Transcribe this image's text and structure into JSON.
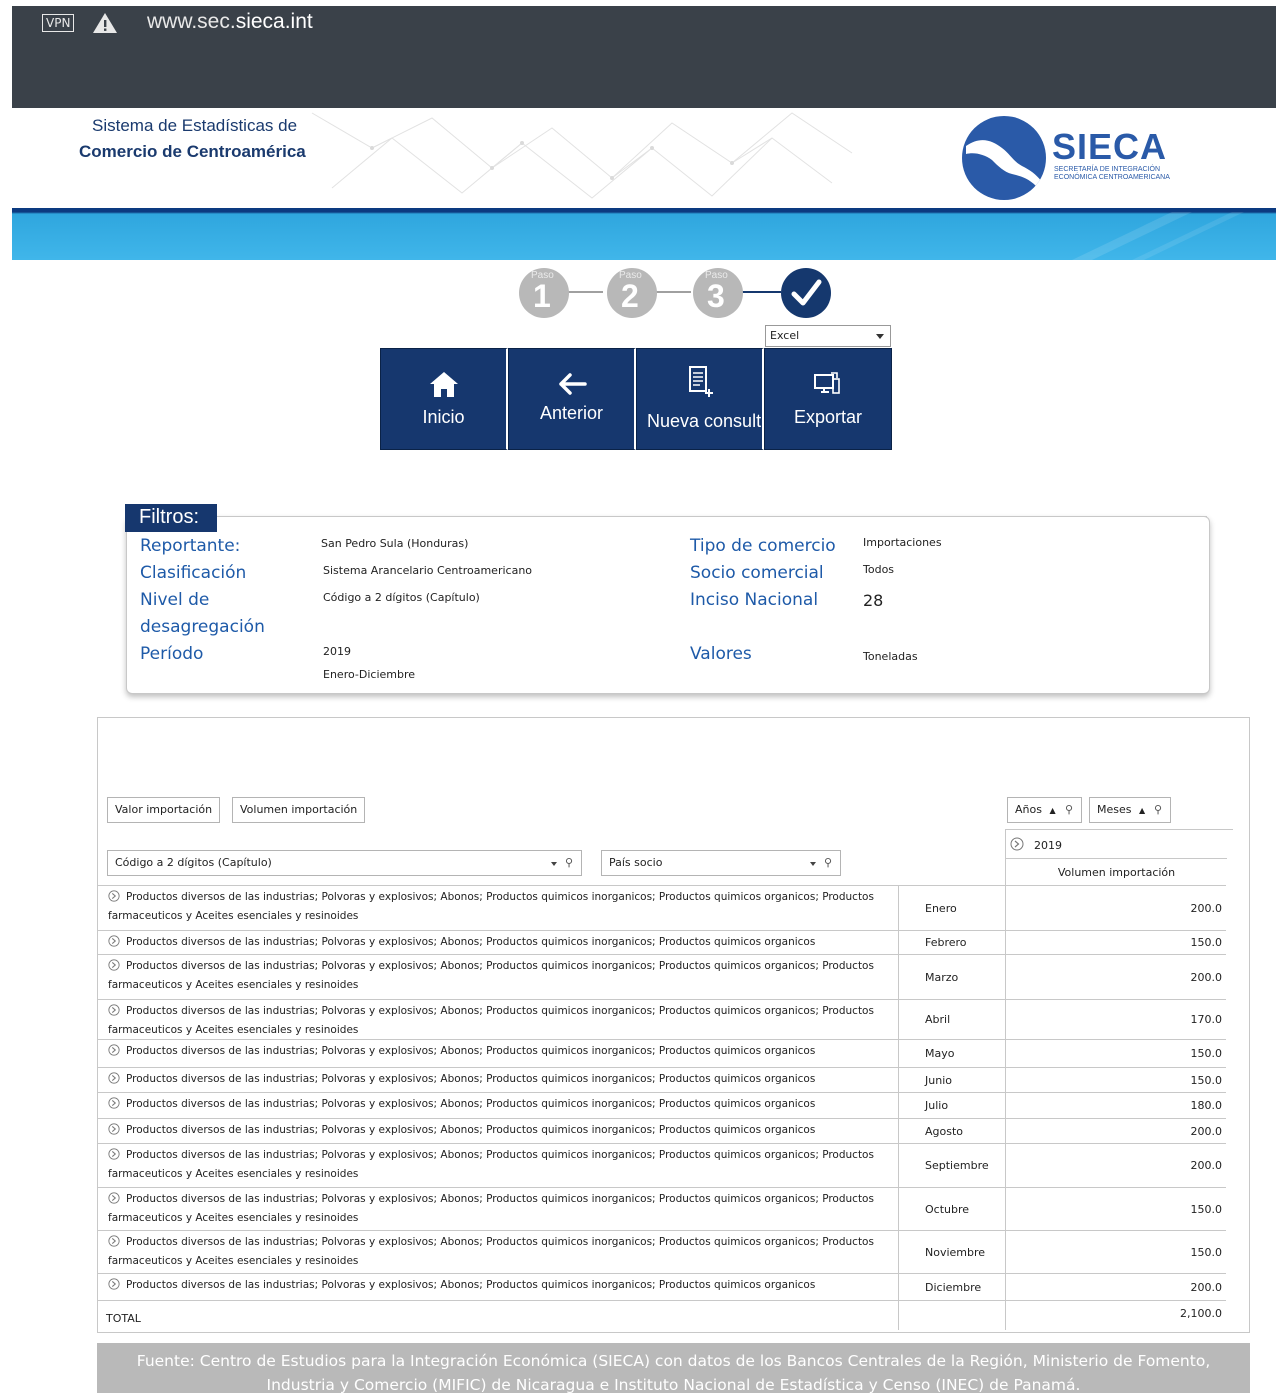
{
  "browser": {
    "vpn_label": "VPN",
    "url_prefix": "www.sec.",
    "url_domain": "sieca.int"
  },
  "header": {
    "title_line1": "Sistema de Estadísticas de",
    "title_line2": "Comercio de Centroamérica",
    "logo_text": "SIECA",
    "logo_subtitle": "SECRETARÍA DE INTEGRACIÓN ECONÓMICA CENTROAMERICANA",
    "brand_color": "#16376e",
    "accent_color": "#40b6ea"
  },
  "steps": [
    {
      "paso": "Paso",
      "num": "1",
      "state": "pending"
    },
    {
      "paso": "Paso",
      "num": "2",
      "state": "pending"
    },
    {
      "paso": "Paso",
      "num": "3",
      "state": "pending"
    },
    {
      "paso": "",
      "num": "",
      "state": "done",
      "icon": "check-icon"
    }
  ],
  "export_select": {
    "value": "Excel"
  },
  "nav": [
    {
      "label": "Inicio",
      "icon": "home-icon"
    },
    {
      "label": "Anterior",
      "icon": "arrow-left-icon"
    },
    {
      "label": "Nueva consult",
      "icon": "new-document-icon"
    },
    {
      "label": "Exportar",
      "icon": "export-icon"
    }
  ],
  "filters": {
    "title": "Filtros:",
    "reportante_label": "Reportante:",
    "reportante_value": "San Pedro Sula (Honduras)",
    "clasificacion_label": "Clasificación",
    "clasificacion_value": "Sistema Arancelario Centroamericano",
    "nivel_label_1": "Nivel de",
    "nivel_label_2": "desagregación",
    "nivel_value": "Código a 2 dígitos (Capítulo)",
    "periodo_label": "Período",
    "periodo_value_1": "2019",
    "periodo_value_2": "Enero-Diciembre",
    "tipo_label": "Tipo de comercio",
    "tipo_value": "Importaciones",
    "socio_label": "Socio comercial",
    "socio_value": "Todos",
    "inciso_label": "Inciso Nacional",
    "inciso_value": "28",
    "valores_label": "Valores",
    "valores_value": "Toneladas"
  },
  "pivot": {
    "measure_chip_1": "Valor importación",
    "measure_chip_2": "Volumen importación",
    "col_chip_1": "Años",
    "col_chip_2": "Meses",
    "row_field": "Código a 2 dígitos (Capítulo)",
    "row_field_2": "País socio",
    "year": "2019",
    "measure_header": "Volumen importación",
    "rows": [
      {
        "product": "Productos diversos de las industrias;  Polvoras y explosivos; Abonos; Productos quimicos inorganicos; Productos quimicos organicos; Productos farmaceuticos y Aceites esenciales y resinoides",
        "month": "Enero",
        "value": "200.0"
      },
      {
        "product": "Productos diversos de las industrias;  Polvoras y explosivos; Abonos; Productos quimicos inorganicos; Productos quimicos organicos",
        "month": "Febrero",
        "value": "150.0"
      },
      {
        "product": "Productos diversos de las industrias;  Polvoras y explosivos; Abonos; Productos quimicos inorganicos; Productos quimicos organicos; Productos farmaceuticos y Aceites esenciales y resinoides",
        "month": "Marzo",
        "value": "200.0"
      },
      {
        "product": "Productos diversos de las industrias;  Polvoras y explosivos; Abonos; Productos quimicos inorganicos; Productos quimicos organicos; Productos farmaceuticos y Aceites esenciales y resinoides",
        "month": "Abril",
        "value": "170.0"
      },
      {
        "product": "Productos diversos de las industrias;  Polvoras y explosivos; Abonos; Productos quimicos inorganicos; Productos quimicos organicos",
        "month": "Mayo",
        "value": "150.0"
      },
      {
        "product": "Productos diversos de las industrias;  Polvoras y explosivos; Abonos; Productos quimicos inorganicos; Productos quimicos organicos",
        "month": "Junio",
        "value": "150.0"
      },
      {
        "product": "Productos diversos de las industrias;  Polvoras y explosivos; Abonos; Productos quimicos inorganicos; Productos quimicos organicos",
        "month": "Julio",
        "value": "180.0"
      },
      {
        "product": "Productos diversos de las industrias;  Polvoras y explosivos; Abonos; Productos quimicos inorganicos; Productos quimicos organicos",
        "month": "Agosto",
        "value": "200.0"
      },
      {
        "product": "Productos diversos de las industrias;  Polvoras y explosivos; Abonos; Productos quimicos inorganicos; Productos quimicos organicos; Productos farmaceuticos y Aceites esenciales y resinoides",
        "month": "Septiembre",
        "value": "200.0"
      },
      {
        "product": "Productos diversos de las industrias;  Polvoras y explosivos; Abonos; Productos quimicos inorganicos; Productos quimicos organicos; Productos farmaceuticos y Aceites esenciales y resinoides",
        "month": "Octubre",
        "value": "150.0"
      },
      {
        "product": "Productos diversos de las industrias;  Polvoras y explosivos; Abonos; Productos quimicos inorganicos; Productos quimicos organicos; Productos farmaceuticos y Aceites esenciales y resinoides",
        "month": "Noviembre",
        "value": "150.0"
      },
      {
        "product": "Productos diversos de las industrias;  Polvoras y explosivos; Abonos; Productos quimicos inorganicos; Productos quimicos organicos",
        "month": "Diciembre",
        "value": "200.0"
      }
    ],
    "total_label": "TOTAL",
    "total_value": "2,100.0"
  },
  "source": {
    "line1": "Fuente: Centro de Estudios para la Integración Económica (SIECA) con datos de los Bancos Centrales de la Región, Ministerio de Fomento,",
    "line2": "Industria y Comercio (MIFIC) de Nicaragua e Instituto Nacional de Estadística y Censo (INEC) de Panamá."
  }
}
